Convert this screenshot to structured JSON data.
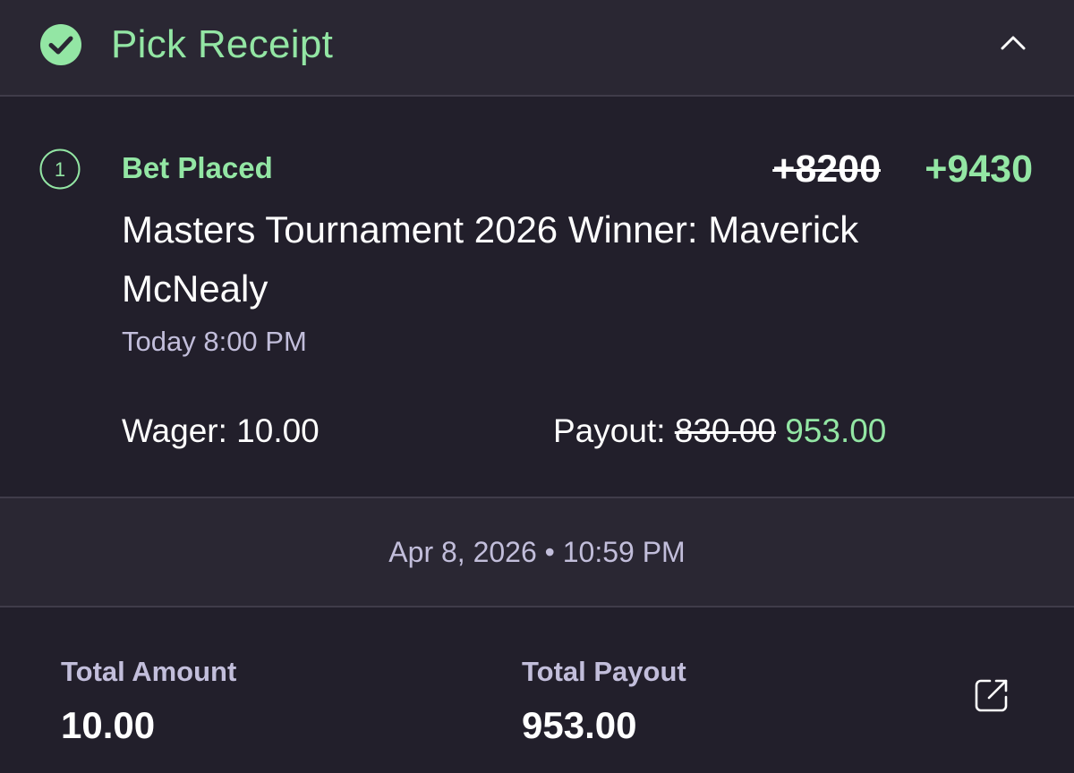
{
  "header": {
    "title": "Pick Receipt",
    "status_icon": "check-circle-icon",
    "collapse_icon": "chevron-up-icon"
  },
  "bet": {
    "leg_number": "1",
    "status": "Bet Placed",
    "odds_old": "+8200",
    "odds_new": "+9430",
    "market": "Masters Tournament 2026 Winner: Maverick McNealy",
    "event_time": "Today 8:00 PM",
    "wager_label": "Wager:",
    "wager_value": "10.00",
    "payout_label": "Payout:",
    "payout_old": "830.00",
    "payout_new": "953.00"
  },
  "placed_datetime": "Apr 8, 2026 • 10:59 PM",
  "totals": {
    "amount_label": "Total Amount",
    "amount_value": "10.00",
    "payout_label": "Total Payout",
    "payout_value": "953.00",
    "share_icon": "share-icon"
  },
  "colors": {
    "accent_green": "#93e6a4",
    "background": "#221f2b",
    "panel": "#2a2733",
    "muted_text": "#c2bedb",
    "divider": "#403c4a"
  }
}
